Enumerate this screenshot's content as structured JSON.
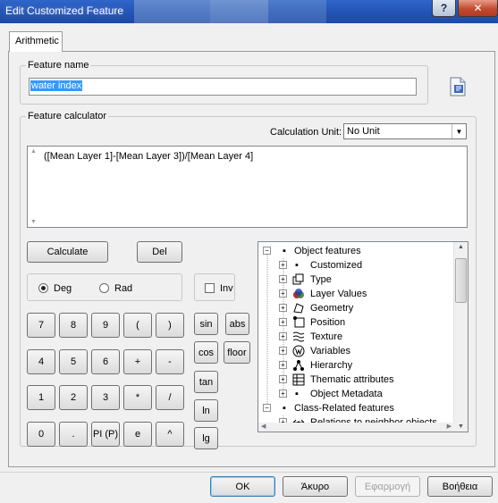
{
  "window": {
    "title": "Edit Customized Feature",
    "help_glyph": "?",
    "close_glyph": "✕"
  },
  "tabs": [
    {
      "label": "Arithmetic",
      "selected": true
    }
  ],
  "feature_name": {
    "legend": "Feature name",
    "value": "water index"
  },
  "feature_calculator": {
    "legend": "Feature calculator",
    "calculation_unit_label": "Calculation Unit:",
    "calculation_unit_value": "No Unit",
    "expression": "([Mean Layer 1]-[Mean Layer 3])/[Mean Layer 4]"
  },
  "buttons": {
    "calculate": "Calculate",
    "del": "Del"
  },
  "angle_mode": {
    "deg": "Deg",
    "rad": "Rad",
    "selected": "Deg"
  },
  "inv": {
    "label": "Inv",
    "checked": false
  },
  "keypad": [
    [
      "7",
      "8",
      "9",
      "(",
      ")"
    ],
    [
      "4",
      "5",
      "6",
      "+",
      "-"
    ],
    [
      "1",
      "2",
      "3",
      "*",
      "/"
    ],
    [
      "0",
      ".",
      "PI (P)",
      "e",
      "^"
    ]
  ],
  "functions": {
    "sin": "sin",
    "abs": "abs",
    "cos": "cos",
    "floor": "floor",
    "tan": "tan",
    "ln": "ln",
    "lg": "lg"
  },
  "tree": [
    {
      "label": "Object features",
      "level": 0,
      "expander": "−",
      "icon": "square-bullet-icon"
    },
    {
      "label": "Customized",
      "level": 1,
      "expander": "+",
      "icon": "square-bullet-icon"
    },
    {
      "label": "Type",
      "level": 1,
      "expander": "+",
      "icon": "type-icon"
    },
    {
      "label": "Layer Values",
      "level": 1,
      "expander": "+",
      "icon": "layer-values-icon"
    },
    {
      "label": "Geometry",
      "level": 1,
      "expander": "+",
      "icon": "geometry-icon"
    },
    {
      "label": "Position",
      "level": 1,
      "expander": "+",
      "icon": "position-icon"
    },
    {
      "label": "Texture",
      "level": 1,
      "expander": "+",
      "icon": "texture-icon"
    },
    {
      "label": "Variables",
      "level": 1,
      "expander": "+",
      "icon": "variables-icon"
    },
    {
      "label": "Hierarchy",
      "level": 1,
      "expander": "+",
      "icon": "hierarchy-icon"
    },
    {
      "label": "Thematic attributes",
      "level": 1,
      "expander": "+",
      "icon": "thematic-attributes-icon"
    },
    {
      "label": "Object Metadata",
      "level": 1,
      "expander": "+",
      "icon": "square-bullet-icon"
    },
    {
      "label": "Class-Related features",
      "level": 0,
      "expander": "−",
      "icon": "square-bullet-icon"
    },
    {
      "label": "Relations to neighbor objects",
      "level": 1,
      "expander": "+",
      "icon": "relations-icon"
    }
  ],
  "dialog_buttons": {
    "ok": "OK",
    "cancel": "Άκυρο",
    "apply": "Εφαρμογή",
    "help": "Βοήθεια"
  },
  "colors": {
    "selection": "#3399ff",
    "titlebar": "#2456b8"
  }
}
